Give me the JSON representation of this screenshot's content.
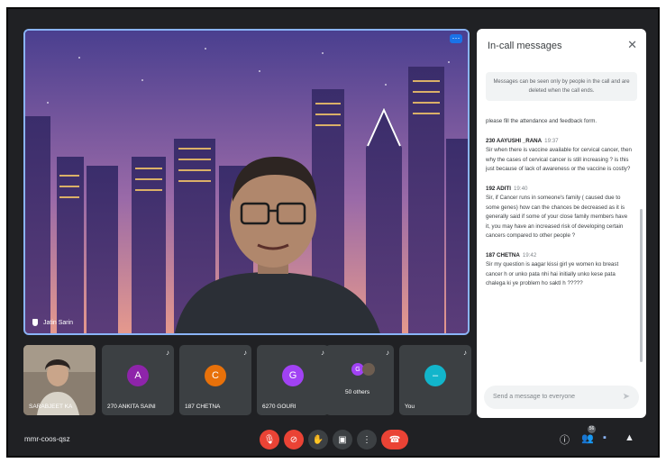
{
  "main_video": {
    "participant_name": "Jatin Sarin"
  },
  "participants": [
    {
      "name": "SARABJEET KA",
      "initial": "",
      "color": ""
    },
    {
      "name": "270 ANKITA SAINI",
      "initial": "A",
      "color": "#8e24aa"
    },
    {
      "name": "187 CHETNA",
      "initial": "C",
      "color": "#e8710a"
    },
    {
      "name": "6270 GOURI",
      "initial": "G",
      "color": "#a142f4"
    },
    {
      "name": "50 others",
      "initial": "G",
      "color": "#a142f4"
    },
    {
      "name": "You",
      "initial": "",
      "color": "#12b5cb"
    }
  ],
  "chat": {
    "title": "In-call messages",
    "notice": "Messages can be seen only by people in the call and are deleted when the call ends.",
    "messages": [
      {
        "sender": "",
        "time": "",
        "text": "please fill the attendance and feedback form."
      },
      {
        "sender": "230 AAYUSHI _RANA",
        "time": "19:37",
        "text": "Sir when there is vaccine available for cervical cancer, then why the cases of cervical cancer is still increasing ? is this just because of lack of awareness or the vaccine is costly?"
      },
      {
        "sender": "192 ADITI",
        "time": "19:40",
        "text": "Sir, if Cancer runs in someone's family ( caused due to some genes) how can the chances be decreased as it is generally said if some of your close family members have it, you may have an increased risk of developing certain cancers compared to other people ?"
      },
      {
        "sender": "187 CHETNA",
        "time": "19:42",
        "text": "Sir my question is aagar kissi girl ye women ko breast cancer h or unko pata nhi hai initially unko kese pata chalega ki ye problem ho saktI h ?????"
      }
    ],
    "input_placeholder": "Send a message to everyone"
  },
  "meeting_code": "mmr-coos-qsz",
  "people_count": "56",
  "colors": {
    "background": "#202124",
    "accent": "#8ab4f8",
    "danger": "#ea4335",
    "tile": "#3c4043"
  }
}
